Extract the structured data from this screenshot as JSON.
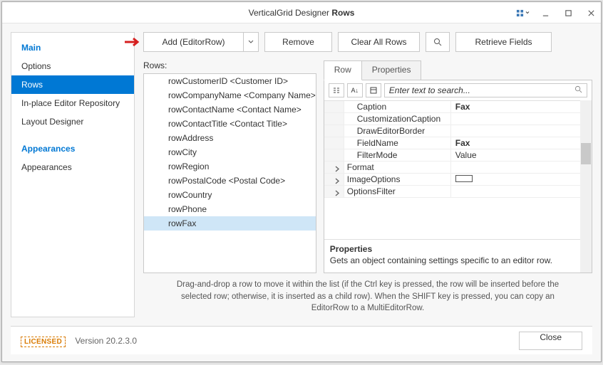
{
  "title_prefix": "VerticalGrid Designer",
  "title_bold": "Rows",
  "sidebar": {
    "head1": "Main",
    "items1": [
      "Options",
      "Rows",
      "In-place Editor Repository",
      "Layout Designer"
    ],
    "selected1": "Rows",
    "head2": "Appearances",
    "items2": [
      "Appearances"
    ]
  },
  "toolbar": {
    "add": "Add (EditorRow)",
    "remove": "Remove",
    "clear": "Clear All Rows",
    "retrieve": "Retrieve Fields"
  },
  "rows": {
    "label": "Rows:",
    "items": [
      "rowCustomerID <Customer ID>",
      "rowCompanyName <Company Name>",
      "rowContactName <Contact Name>",
      "rowContactTitle <Contact Title>",
      "rowAddress",
      "rowCity",
      "rowRegion",
      "rowPostalCode <Postal Code>",
      "rowCountry",
      "rowPhone",
      "rowFax"
    ],
    "selected": "rowFax"
  },
  "tabs": {
    "row": "Row",
    "properties": "Properties",
    "active": "Row"
  },
  "search_placeholder": "Enter text to search...",
  "properties": [
    {
      "name": "Caption",
      "value": "Fax",
      "bold": true,
      "indent": 2
    },
    {
      "name": "CustomizationCaption",
      "value": "",
      "indent": 2
    },
    {
      "name": "DrawEditorBorder",
      "value": "",
      "indent": 2
    },
    {
      "name": "FieldName",
      "value": "Fax",
      "bold": true,
      "indent": 2,
      "arrow": true
    },
    {
      "name": "FilterMode",
      "value": "Value",
      "indent": 2
    },
    {
      "name": "Format",
      "value": "",
      "indent": 1,
      "expandable": true
    },
    {
      "name": "ImageOptions",
      "value": "__rect__",
      "indent": 1,
      "expandable": true
    },
    {
      "name": "OptionsFilter",
      "value": "",
      "indent": 1,
      "expandable": true
    }
  ],
  "desc": {
    "title": "Properties",
    "text": "Gets an object containing settings specific to an editor row."
  },
  "hint": "Drag-and-drop a row to move it within the list (if the Ctrl key is pressed, the row will be inserted before the selected row; otherwise, it is inserted as a child row). When the SHIFT key is pressed, you can copy an EditorRow to a MultiEditorRow.",
  "footer": {
    "licensed": "LICENSED",
    "version": "Version 20.2.3.0",
    "close": "Close"
  }
}
